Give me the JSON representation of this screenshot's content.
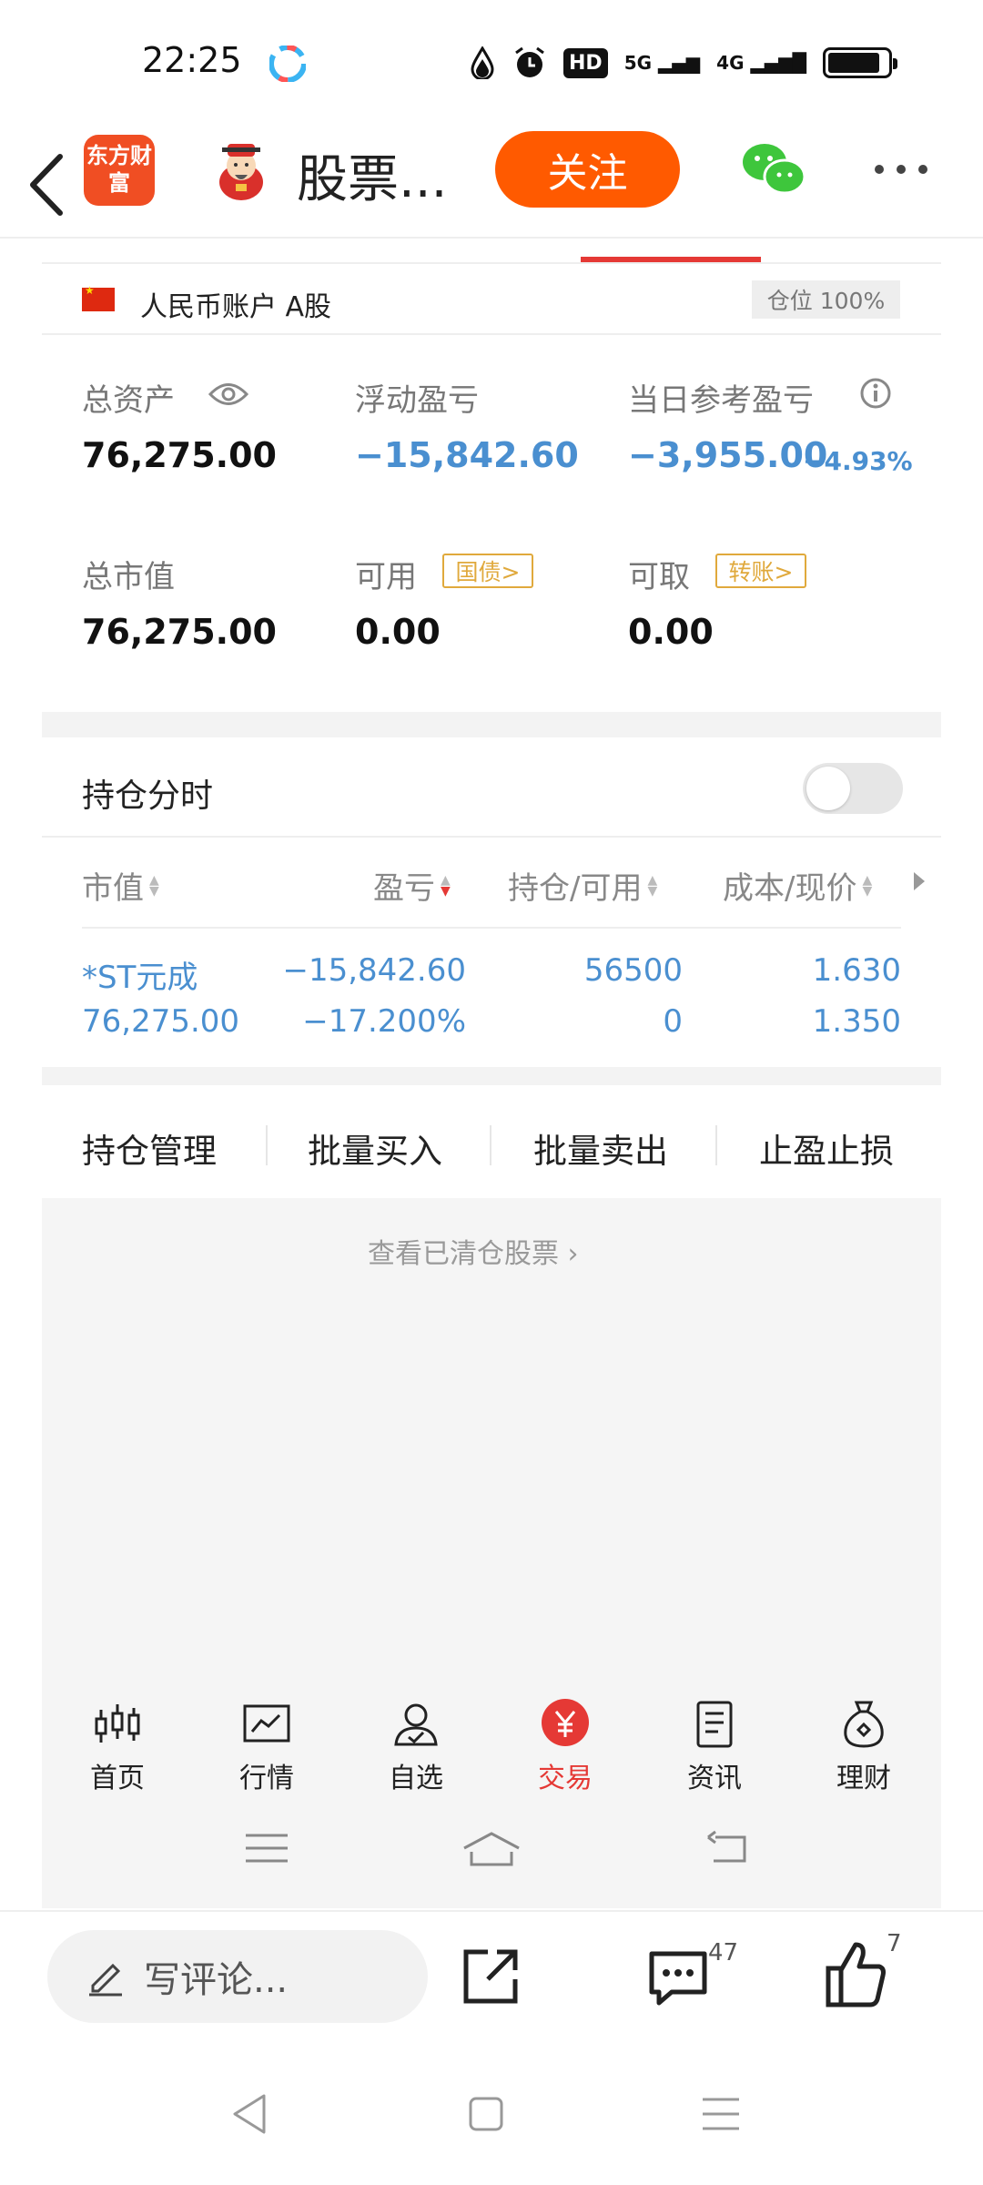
{
  "status_bar": {
    "time": "22:25",
    "hd_label": "HD",
    "net_5g": "5G",
    "net_4g": "4G"
  },
  "header": {
    "logo_text": "东方财富",
    "title": "股票...",
    "follow_label": "关注"
  },
  "account": {
    "label": "人民币账户 A股",
    "position_badge": "仓位 100%"
  },
  "summary": {
    "total_assets_label": "总资产",
    "total_assets": "76,275.00",
    "floating_pl_label": "浮动盈亏",
    "floating_pl": "−15,842.60",
    "daily_pl_label": "当日参考盈亏",
    "daily_pl": "−3,955.00",
    "daily_pl_pct": "−4.93%",
    "market_value_label": "总市值",
    "market_value": "76,275.00",
    "available_label": "可用",
    "available": "0.00",
    "bond_tag": "国债>",
    "withdrawable_label": "可取",
    "withdrawable": "0.00",
    "transfer_tag": "转账>"
  },
  "holdings": {
    "intraday_label": "持仓分时",
    "columns": [
      "市值",
      "盈亏",
      "持仓/可用",
      "成本/现价"
    ],
    "rows": [
      {
        "name": "*ST元成",
        "market_value": "76,275.00",
        "pl": "−15,842.60",
        "pl_pct": "−17.200%",
        "position": "56500",
        "available": "0",
        "cost": "1.630",
        "price": "1.350"
      }
    ]
  },
  "actions": [
    "持仓管理",
    "批量买入",
    "批量卖出",
    "止盈止损"
  ],
  "cleared_link": "查看已清仓股票",
  "bottom_nav": [
    {
      "label": "首页",
      "icon": "candlestick-icon"
    },
    {
      "label": "行情",
      "icon": "chart-icon"
    },
    {
      "label": "自选",
      "icon": "user-check-icon"
    },
    {
      "label": "交易",
      "icon": "yuan-icon",
      "active": true
    },
    {
      "label": "资讯",
      "icon": "document-icon"
    },
    {
      "label": "理财",
      "icon": "money-bag-icon"
    }
  ],
  "comment_bar": {
    "placeholder": "写评论...",
    "comment_count": "47",
    "like_count": "7"
  },
  "colors": {
    "accent_orange": "#ff5a00",
    "loss_blue": "#4a8fd0",
    "active_red": "#e53935",
    "tag_gold": "#e0a93c"
  }
}
